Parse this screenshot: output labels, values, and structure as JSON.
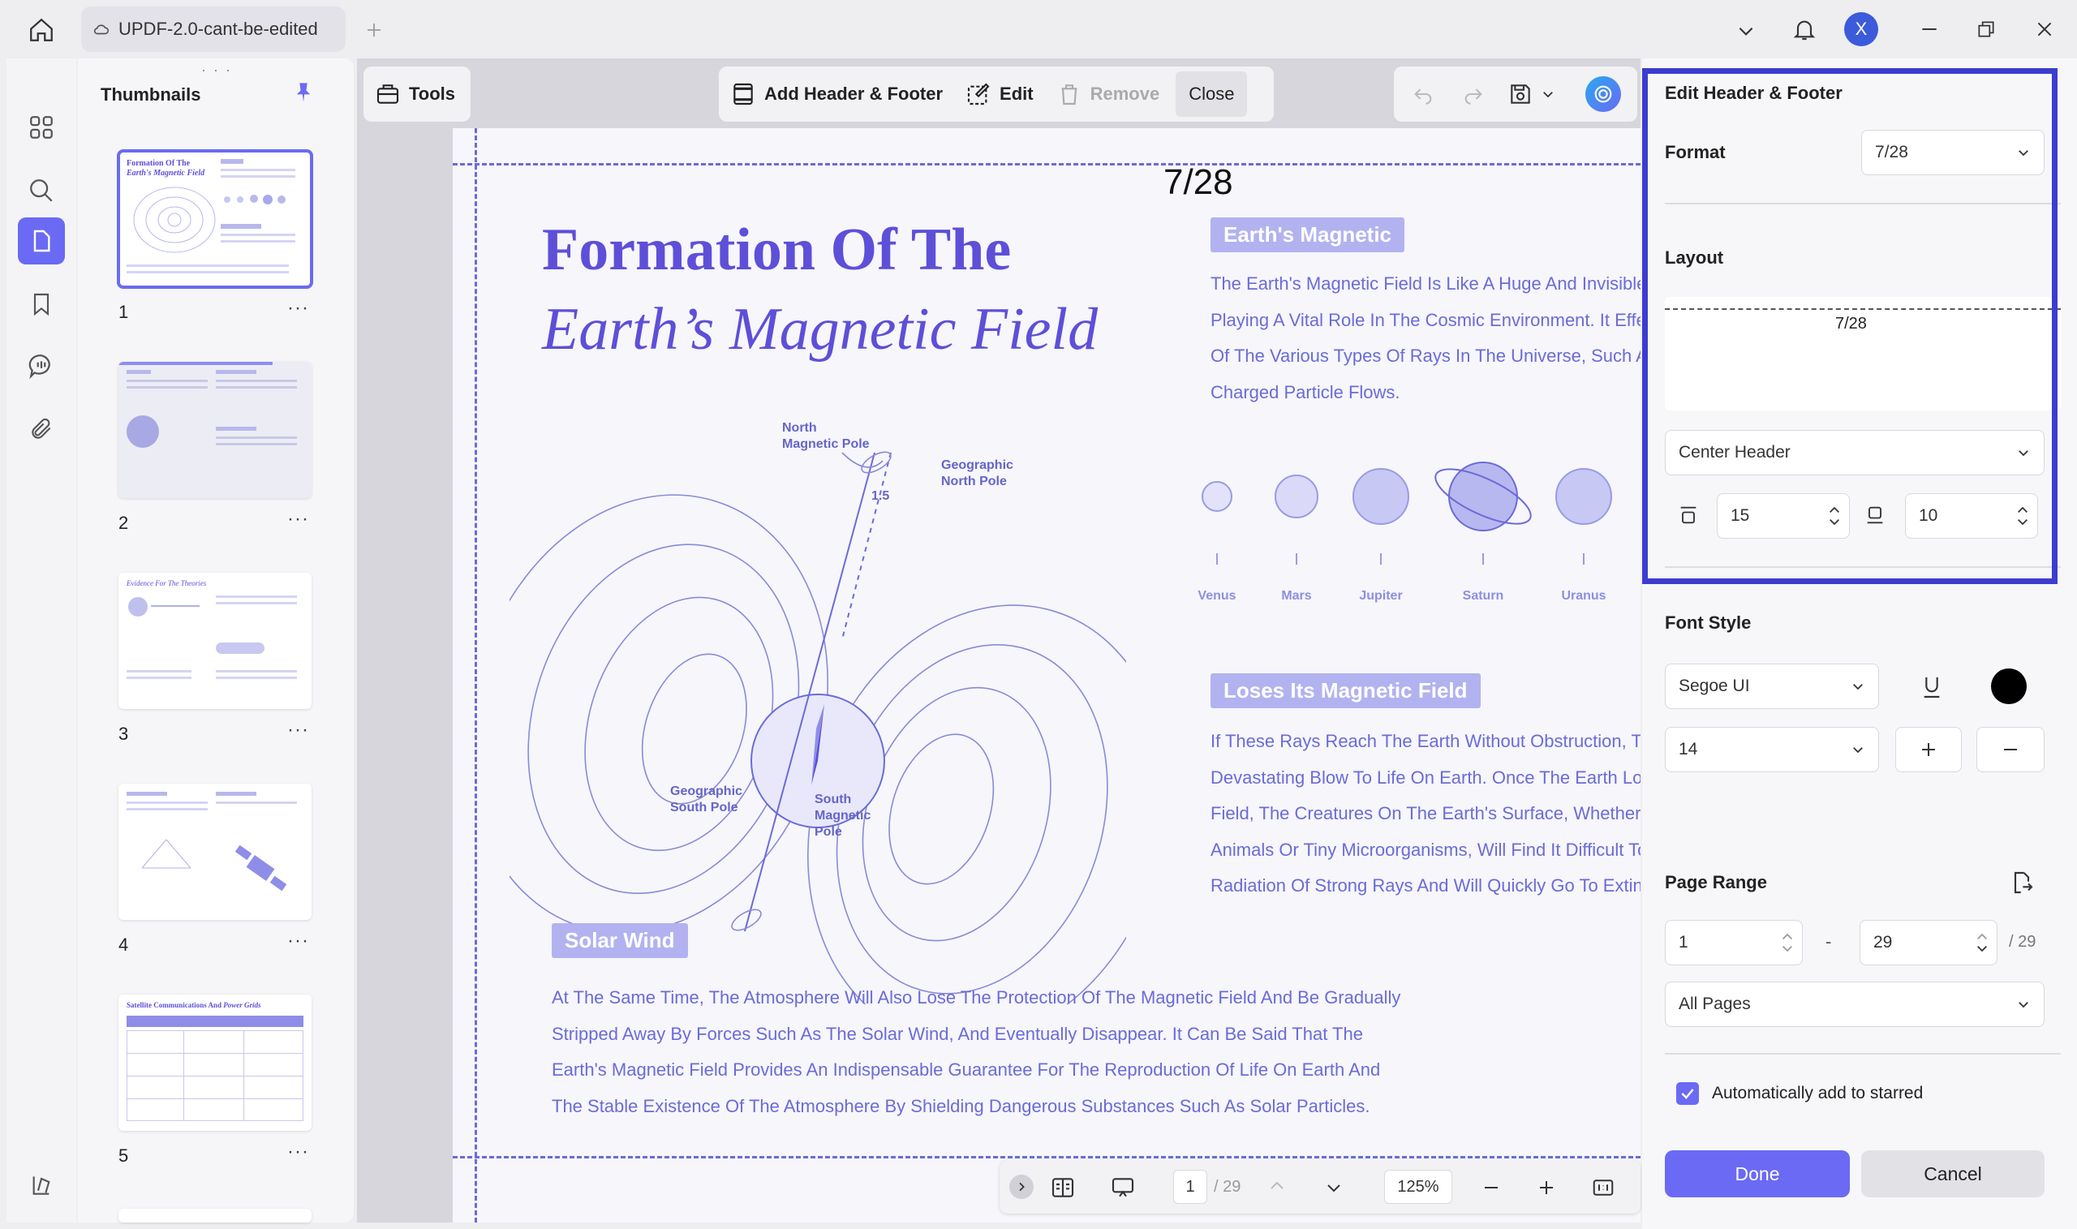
{
  "titlebar": {
    "tab_title": "UPDF-2.0-cant-be-edited",
    "avatar_letter": "X"
  },
  "thumbnails": {
    "title": "Thumbnails",
    "pages": [
      {
        "number": "1",
        "more": "···"
      },
      {
        "number": "2",
        "more": "···"
      },
      {
        "number": "3",
        "more": "···"
      },
      {
        "number": "4",
        "more": "···"
      },
      {
        "number": "5",
        "more": "···"
      }
    ]
  },
  "toolbar": {
    "tools_label": "Tools",
    "add_header_footer_label": "Add Header & Footer",
    "edit_label": "Edit",
    "remove_label": "Remove",
    "close_label": "Close"
  },
  "document": {
    "header_text": "7/28",
    "title_line1": "Formation Of The",
    "title_line2": "Earth’s Magnetic Field",
    "diagram": {
      "north_magnetic": [
        "North",
        "Magnetic Pole"
      ],
      "geographic_north": [
        "Geographic",
        "North Pole"
      ],
      "angle": "1.5",
      "geographic_south": [
        "Geographic",
        "South Pole"
      ],
      "south_magnetic": [
        "South",
        "Magnetic",
        "Pole"
      ]
    },
    "section1": {
      "heading": "Earth's Magnetic",
      "lines": [
        "The Earth's Magnetic Field Is Like A Huge And Invisible",
        "Playing A Vital Role In The Cosmic Environment. It Effe",
        "Of The Various Types Of Rays In The Universe, Such A",
        "Charged Particle Flows."
      ]
    },
    "planets": [
      "Venus",
      "Mars",
      "Jupiter",
      "Saturn",
      "Uranus"
    ],
    "section2": {
      "heading": "Loses Its Magnetic Field",
      "lines": [
        "If These Rays Reach The Earth Without Obstruction, Th",
        "Devastating Blow To Life On Earth. Once The Earth Los",
        "Field, The Creatures On The Earth's Surface, Whether",
        "Animals Or Tiny Microorganisms, Will Find It Difficult To",
        "Radiation Of Strong Rays And Will Quickly Go To Extinc"
      ]
    },
    "section3": {
      "heading": "Solar Wind",
      "lines": [
        "At The Same Time, The Atmosphere Will Also Lose The Protection Of The Magnetic Field And Be Gradually",
        "Stripped Away By Forces Such As The Solar Wind, And Eventually Disappear. It Can Be Said That The",
        "Earth's Magnetic Field Provides An Indispensable Guarantee For The Reproduction Of Life On Earth And",
        "The Stable Existence Of The Atmosphere By Shielding Dangerous Substances Such As Solar Particles."
      ]
    }
  },
  "bottombar": {
    "current_page": "1",
    "total_pages": "/ 29",
    "zoom": "125%"
  },
  "panel": {
    "title": "Edit Header & Footer",
    "format_label": "Format",
    "format_value": "7/28",
    "layout_label": "Layout",
    "layout_preview_text": "7/28",
    "position_value": "Center Header",
    "margin_top": "15",
    "margin_bottom": "10",
    "font_style_label": "Font Style",
    "font_value": "Segoe UI",
    "font_size": "14",
    "text_color": "#000000",
    "page_range_label": "Page Range",
    "range_from": "1",
    "range_dash": "-",
    "range_to": "29",
    "range_total": "/ 29",
    "pages_value": "All Pages",
    "auto_star_label": "Automatically add to starred",
    "auto_star_checked": true,
    "done_label": "Done",
    "cancel_label": "Cancel"
  },
  "colors": {
    "accent": "#6a6af4",
    "doc_purple": "#5e4fd8",
    "highlight_border": "#3c3cd0"
  }
}
